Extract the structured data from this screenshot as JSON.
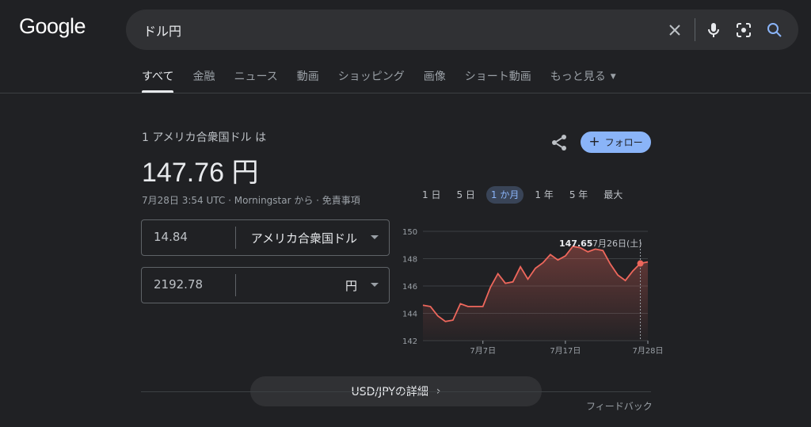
{
  "logo": "Google",
  "search": {
    "query": "ドル円"
  },
  "tabs": [
    "すべて",
    "金融",
    "ニュース",
    "動画",
    "ショッピング",
    "画像",
    "ショート動画",
    "もっと見る"
  ],
  "result": {
    "subtitle": "1 アメリカ合衆国ドル は",
    "rate": "147.76 円",
    "meta": "7月28日 3:54 UTC · Morningstar から · 免責事項",
    "follow_label": "フォロー"
  },
  "converter": {
    "from_value": "14.84",
    "from_currency": "アメリカ合衆国ドル",
    "to_value": "2192.78",
    "to_currency": "円"
  },
  "ranges": [
    "1 日",
    "5 日",
    "1 か月",
    "1 年",
    "5 年",
    "最大"
  ],
  "active_range": "1 か月",
  "chart_data": {
    "type": "area",
    "x_labels": [
      "7月7日",
      "7月17日",
      "7月28日"
    ],
    "y_ticks": [
      150,
      148,
      146,
      144,
      142
    ],
    "ylim": [
      142,
      150
    ],
    "values": [
      144.6,
      144.5,
      143.8,
      143.4,
      143.5,
      144.7,
      144.5,
      144.5,
      144.5,
      145.9,
      146.9,
      146.2,
      146.3,
      147.4,
      146.5,
      147.3,
      147.7,
      148.3,
      147.9,
      148.2,
      148.9,
      148.8,
      148.5,
      148.7,
      148.6,
      147.6,
      146.8,
      146.4,
      147.1,
      147.65,
      147.76
    ],
    "tooltip_value": "147.65",
    "tooltip_date": "7月26日(土)",
    "colors": {
      "line": "#ee675c",
      "axis_text": "#9aa0a6",
      "grid": "#3c4043"
    }
  },
  "details_label": "USD/JPYの詳細",
  "feedback": "フィードバック"
}
